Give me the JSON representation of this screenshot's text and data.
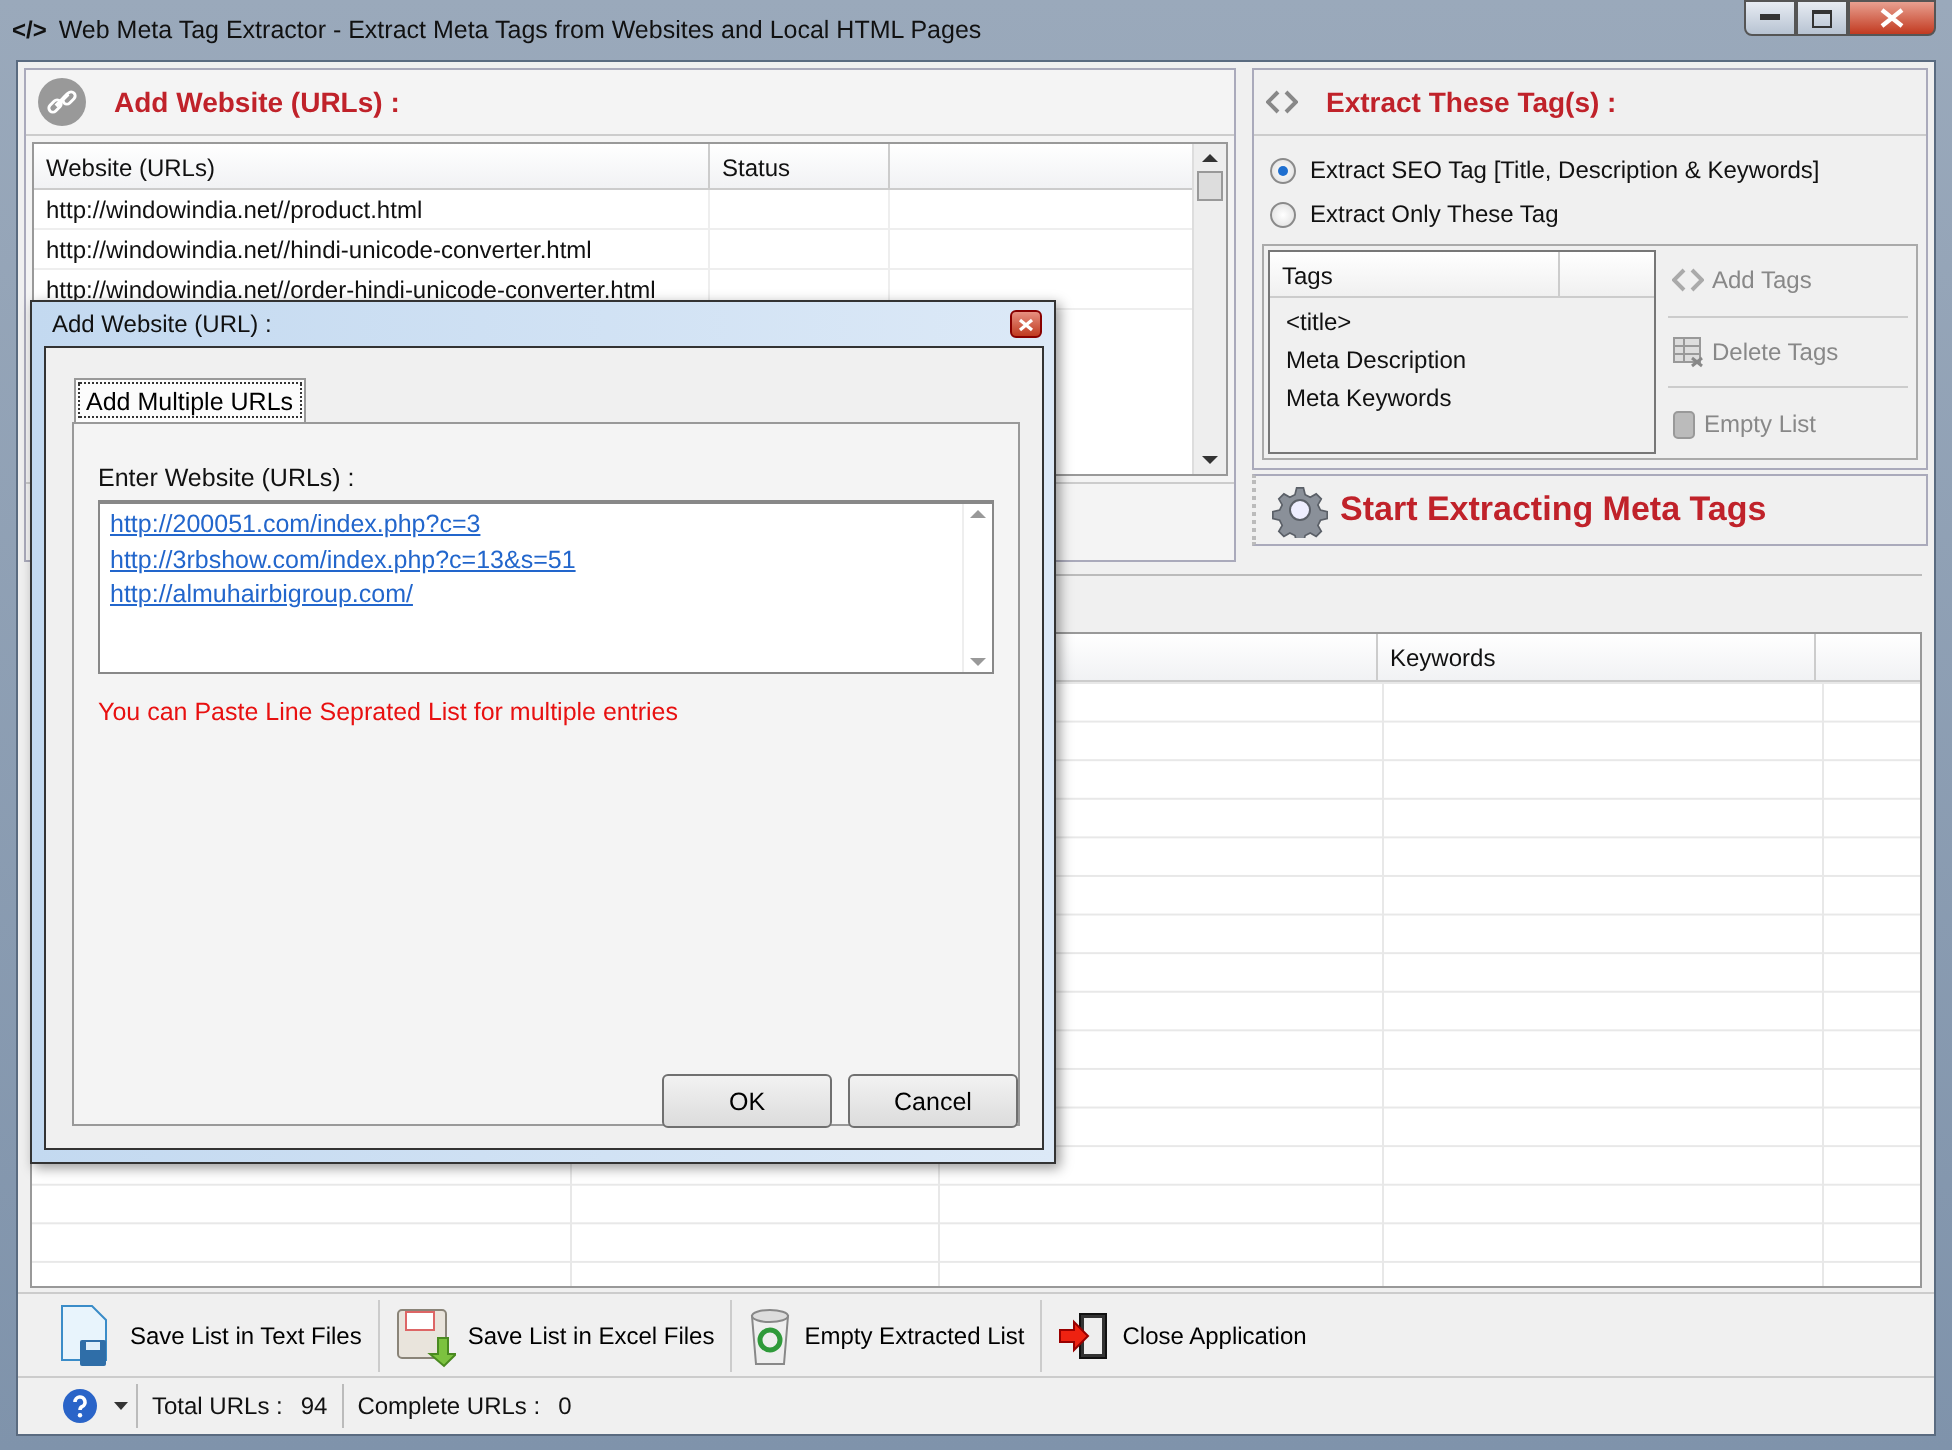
{
  "window": {
    "title": "Web Meta Tag Extractor - Extract Meta Tags from Websites and Local HTML Pages",
    "logo": "</>"
  },
  "url_panel": {
    "title": "Add Website (URLs) :",
    "columns": [
      "Website (URLs)",
      "Status"
    ],
    "rows": [
      {
        "url": "http://windowindia.net//product.html"
      },
      {
        "url": "http://windowindia.net//hindi-unicode-converter.html"
      },
      {
        "url": "http://windowindia.net//order-hindi-unicode-converter.html"
      }
    ]
  },
  "tag_panel": {
    "title": "Extract These Tag(s) :",
    "options": [
      {
        "label": "Extract SEO Tag [Title, Description & Keywords]",
        "selected": true
      },
      {
        "label": "Extract Only These Tag",
        "selected": false
      }
    ],
    "tags_column": "Tags",
    "tags": [
      "<title>",
      "Meta Description",
      "Meta Keywords"
    ],
    "actions": [
      {
        "label": "Add Tags",
        "kind": "add",
        "disabled": true
      },
      {
        "label": "Delete Tags",
        "kind": "delete",
        "disabled": true
      },
      {
        "label": "Empty List",
        "kind": "empty",
        "disabled": true
      }
    ],
    "start_button": "Start Extracting Meta Tags"
  },
  "results_table": {
    "keywords_header": "Keywords"
  },
  "toolbar": [
    {
      "label": "Save List in Text Files",
      "kind": "text-file"
    },
    {
      "label": "Save List in Excel Files",
      "kind": "excel-file"
    },
    {
      "label": "Empty Extracted List",
      "kind": "recycle"
    },
    {
      "label": "Close Application",
      "kind": "exit"
    }
  ],
  "status_bar": [
    {
      "label": "Total URLs :",
      "value": "94"
    },
    {
      "label": "Complete URLs :",
      "value": "0"
    }
  ],
  "dialog": {
    "title": "Add Website (URL) :",
    "tab": {
      "label": "Add Multiple URLs",
      "selected": true
    },
    "field_label": "Enter Website (URLs) :",
    "urls": [
      "http://200051.com/index.php?c=3",
      "http://3rbshow.com/index.php?c=13&s=51",
      "http://almuhairbigroup.com/"
    ],
    "hint": "You can Paste Line Seprated List for multiple entries",
    "buttons": [
      "OK",
      "Cancel"
    ]
  }
}
